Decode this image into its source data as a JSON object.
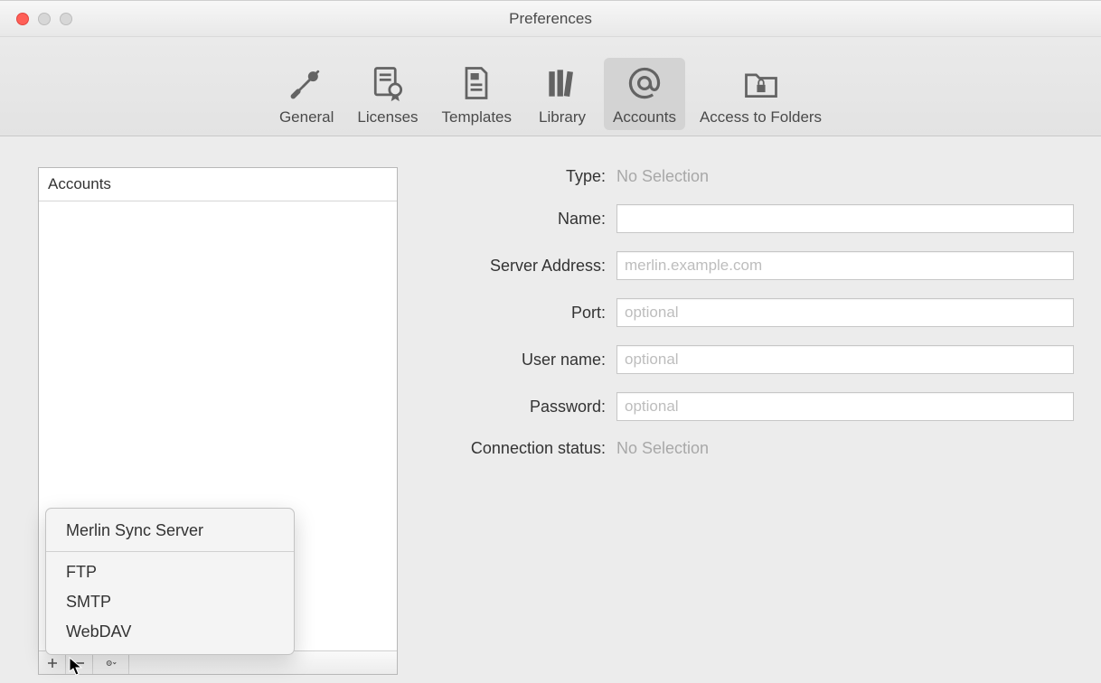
{
  "window": {
    "title": "Preferences"
  },
  "toolbar": {
    "items": [
      {
        "label": "General"
      },
      {
        "label": "Licenses"
      },
      {
        "label": "Templates"
      },
      {
        "label": "Library"
      },
      {
        "label": "Accounts"
      },
      {
        "label": "Access to Folders"
      }
    ]
  },
  "sidebar": {
    "header": "Accounts"
  },
  "popup": {
    "items": [
      "Merlin Sync Server",
      "FTP",
      "SMTP",
      "WebDAV"
    ]
  },
  "form": {
    "type_label": "Type:",
    "type_value": "No Selection",
    "name_label": "Name:",
    "name_value": "",
    "server_label": "Server Address:",
    "server_placeholder": "merlin.example.com",
    "port_label": "Port:",
    "port_placeholder": "optional",
    "user_label": "User name:",
    "user_placeholder": "optional",
    "password_label": "Password:",
    "password_placeholder": "optional",
    "status_label": "Connection status:",
    "status_value": "No Selection"
  }
}
